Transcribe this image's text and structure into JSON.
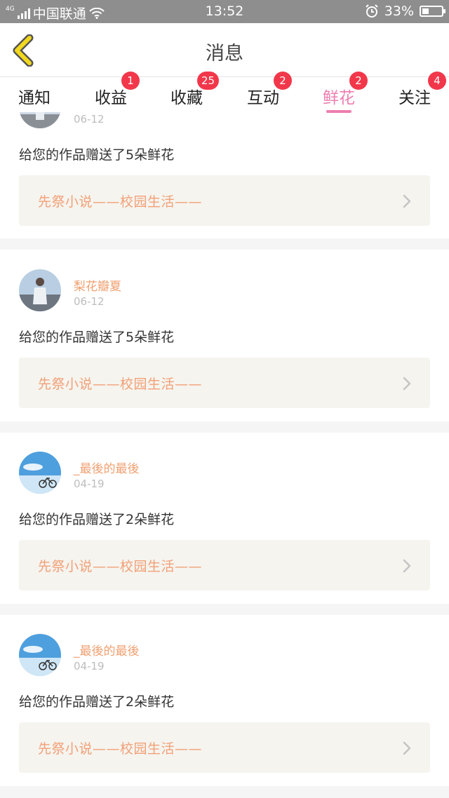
{
  "status_bar": {
    "network_type": "4G",
    "carrier": "中国联通",
    "time": "13:52",
    "battery_percent": "33%",
    "battery_level": 0.33
  },
  "header": {
    "title": "消息",
    "back_icon": "chevron-left-icon"
  },
  "tabs": [
    {
      "label": "通知",
      "badge": ""
    },
    {
      "label": "收益",
      "badge": "1"
    },
    {
      "label": "收藏",
      "badge": "25"
    },
    {
      "label": "互动",
      "badge": "2"
    },
    {
      "label": "鲜花",
      "badge": "2",
      "active": true
    },
    {
      "label": "关注",
      "badge": "4"
    }
  ],
  "colors": {
    "accent_pink": "#ee7eb0",
    "badge_red": "#f2374a",
    "username_orange": "#f0a071",
    "work_title_orange": "#f2a077",
    "work_box_bg": "#f5f4ef"
  },
  "messages": [
    {
      "username": "",
      "date": "06-12",
      "text": "给您的作品赠送了5朵鲜花",
      "work_title": "先祭小说——校园生活——"
    },
    {
      "username": "梨花瓣夏",
      "date": "06-12",
      "text": "给您的作品赠送了5朵鲜花",
      "work_title": "先祭小说——校园生活——"
    },
    {
      "username": "_最後的最後",
      "date": "04-19",
      "text": "给您的作品赠送了2朵鲜花",
      "work_title": "先祭小说——校园生活——"
    },
    {
      "username": "_最後的最後",
      "date": "04-19",
      "text": "给您的作品赠送了2朵鲜花",
      "work_title": "先祭小说——校园生活——"
    }
  ]
}
